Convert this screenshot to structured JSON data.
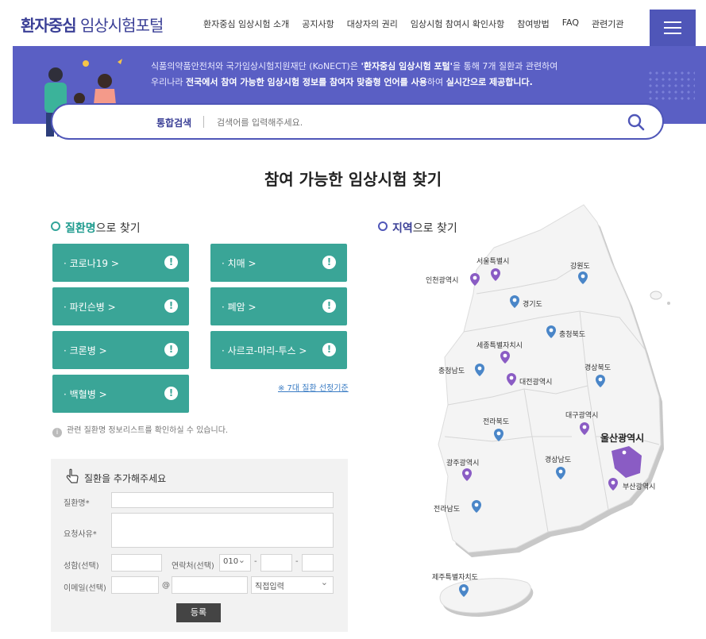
{
  "header": {
    "logo_bold": "환자중심",
    "logo_rest": " 임상시험포털",
    "nav": [
      "환자중심 임상시험 소개",
      "공지사항",
      "대상자의 권리",
      "임상시험 참여시 확인사항",
      "참여방법",
      "FAQ",
      "관련기관"
    ]
  },
  "banner": {
    "line1_pre": "식품의약품안전처와 국가임상시험지원재단 (KoNECT)은 ",
    "line1_bold": "'환자중심 임상시험 포털'",
    "line1_post": "을 통해 7개 질환과 관련하여",
    "line2_pre": "우리나라 ",
    "line2_bold1": "전국에서 참여 가능한 임상시험 정보를 참여자 맞춤형 언어를 사용",
    "line2_mid": "하여 ",
    "line2_bold2": "실시간으로 제공합니다."
  },
  "search": {
    "label": "통합검색",
    "placeholder": "검색어를 입력해주세요."
  },
  "main_title": "참여 가능한 임상시험 찾기",
  "disease": {
    "head_hl": "질환명",
    "head_rest": "으로 찾기",
    "buttons": [
      "· 코로나19  >",
      "· 치매  >",
      "· 파킨슨병  >",
      "· 폐암  >",
      "· 크론병  >",
      "· 사르코-마리-투스  >",
      "· 백혈병  >"
    ],
    "criteria_link": "※ 7대 질환 선정기준",
    "note": "관련 질환명 정보리스트를 확인하실 수 있습니다."
  },
  "form": {
    "title": "질환을 추가해주세요",
    "disease_label": "질환명*",
    "reason_label": "요청사유*",
    "name_label": "성함(선택)",
    "phone_label": "연락처(선택)",
    "phone_prefix": "010",
    "email_label": "이메일(선택)",
    "email_at": "@",
    "email_domain": "직접입력",
    "submit": "등록"
  },
  "region": {
    "head_hl": "지역",
    "head_rest": "으로 찾기",
    "labels": [
      "서울특별시",
      "인천광역시",
      "강원도",
      "경기도",
      "충청북도",
      "세종특별자치시",
      "충청남도",
      "대전광역시",
      "경상북도",
      "전라북도",
      "대구광역시",
      "울산광역시",
      "광주광역시",
      "경상남도",
      "부산광역시",
      "전라남도",
      "제주특별자치도"
    ]
  },
  "colors": {
    "primary": "#4f56b8",
    "teal": "#3aa597",
    "pin_blue": "#4a86c8",
    "pin_purple": "#8a5cc4"
  }
}
